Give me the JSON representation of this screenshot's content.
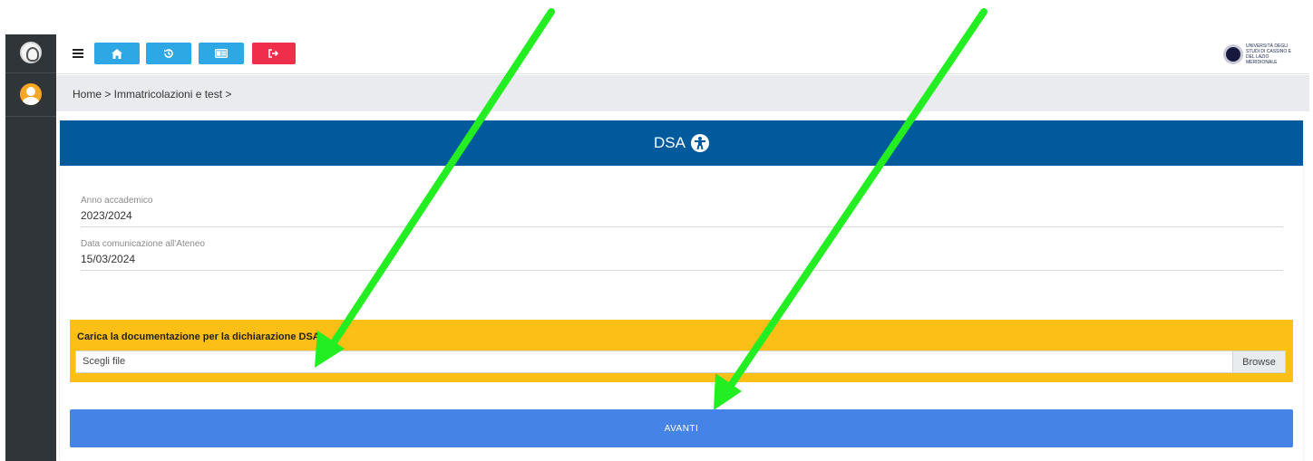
{
  "topbar": {
    "buttons": [
      {
        "icon": "home-icon"
      },
      {
        "icon": "history-icon"
      },
      {
        "icon": "id-card-icon"
      },
      {
        "icon": "logout-icon"
      }
    ],
    "university_logo_text": "UNIVERSITÀ DEGLI STUDI DI CASSINO E DEL LAZIO MERIDIONALE"
  },
  "breadcrumb": "Home > Immatricolazioni e test >",
  "page": {
    "title": "DSA",
    "title_icon": "accessibility-icon"
  },
  "fields": [
    {
      "label": "Anno accademico",
      "value": "2023/2024"
    },
    {
      "label": "Data comunicazione all'Ateneo",
      "value": "15/03/2024"
    }
  ],
  "upload": {
    "title": "Carica la documentazione per la dichiarazione DSA",
    "placeholder": "Scegli file",
    "browse_label": "Browse"
  },
  "submit_label": "AVANTI",
  "colors": {
    "header_blue": "#005a9b",
    "upload_yellow": "#fbbf16",
    "submit_blue": "#4584e6",
    "arrow_green": "#22ee22",
    "logout_red": "#ee2e4b",
    "topbar_button_blue": "#2ea8e5"
  }
}
